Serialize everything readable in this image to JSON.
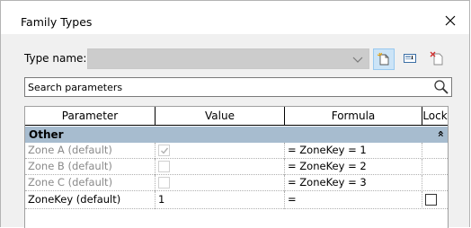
{
  "window": {
    "title": "Family Types",
    "close_icon": "close-icon"
  },
  "type_name": {
    "label": "Type name:",
    "value": "",
    "dropdown_icon": "chevron-down-icon"
  },
  "toolbar": {
    "new_type_icon": "new-type-icon",
    "rename_type_icon": "rename-type-icon",
    "delete_type_icon": "delete-type-icon"
  },
  "search": {
    "placeholder": "Search parameters",
    "icon": "search-icon"
  },
  "grid": {
    "columns": [
      "Parameter",
      "Value",
      "Formula",
      "Lock"
    ],
    "groups": [
      {
        "name": "Other",
        "collapse_glyph": "»",
        "rows": [
          {
            "parameter": "Zone A (default)",
            "value_type": "checkbox",
            "checked": true,
            "value": "",
            "formula": "= ZoneKey = 1",
            "lock": false,
            "enabled": false
          },
          {
            "parameter": "Zone B (default)",
            "value_type": "checkbox",
            "checked": false,
            "value": "",
            "formula": "= ZoneKey = 2",
            "lock": false,
            "enabled": false
          },
          {
            "parameter": "Zone C (default)",
            "value_type": "checkbox",
            "checked": false,
            "value": "",
            "formula": "= ZoneKey = 3",
            "lock": false,
            "enabled": false
          },
          {
            "parameter": "ZoneKey (default)",
            "value_type": "text",
            "checked": false,
            "value": "1",
            "formula": "=",
            "lock": false,
            "enabled": true
          }
        ]
      }
    ]
  },
  "colors": {
    "group_header": "#a7bccf",
    "selected_tool": "#cce4f7",
    "disabled_text": "#8a8a8a"
  }
}
